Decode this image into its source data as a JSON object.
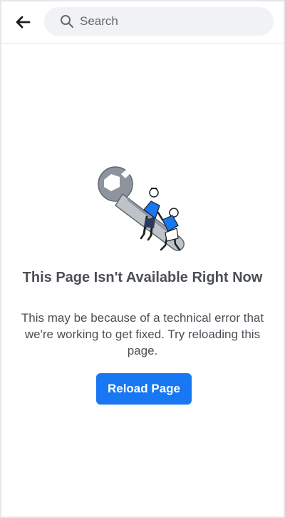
{
  "header": {
    "back_icon": "arrow-left-icon",
    "search_icon": "search-icon",
    "search_placeholder": "Search",
    "search_value": ""
  },
  "main": {
    "illustration": "wrench-workers-illustration",
    "title": "This Page Isn't Available Right Now",
    "message": "This may be because of a technical error that we're working to get fixed. Try reloading this page.",
    "reload_label": "Reload Page"
  },
  "colors": {
    "accent": "#1877f2",
    "text": "#4b4f56",
    "search_bg": "#f0f2f5",
    "border": "#e4e6eb"
  }
}
